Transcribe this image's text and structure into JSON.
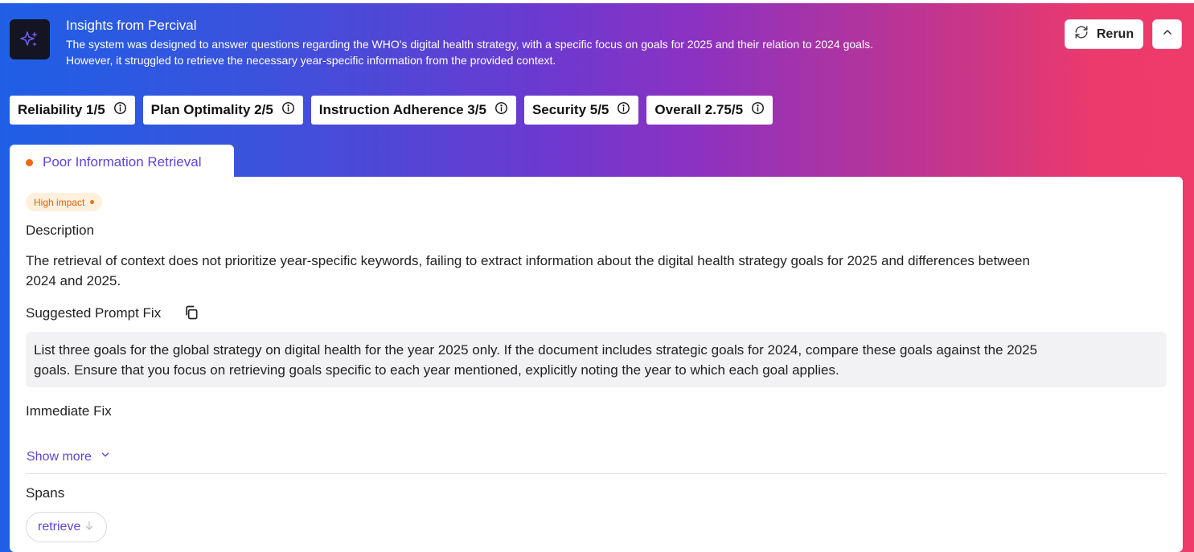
{
  "header": {
    "logo_icon": "sparkles-icon",
    "title": "Insights from Percival",
    "description_lines": [
      "The system was designed to answer questions regarding the WHO's digital health strategy, with a specific focus on goals for 2025 and their relation to 2024 goals.",
      "However, it struggled to retrieve the necessary year-specific information from the provided context."
    ],
    "rerun_label": "Rerun",
    "rerun_icon": "refresh-icon",
    "collapse_icon": "chevron-up-icon"
  },
  "scores": [
    {
      "label": "Reliability 1/5",
      "icon": "info-icon"
    },
    {
      "label": "Plan Optimality 2/5",
      "icon": "info-icon"
    },
    {
      "label": "Instruction Adherence 3/5",
      "icon": "info-icon"
    },
    {
      "label": "Security 5/5",
      "icon": "info-icon"
    },
    {
      "label": "Overall 2.75/5",
      "icon": "info-icon"
    }
  ],
  "tab": {
    "label": "Poor Information Retrieval",
    "dot_color": "#f06a12"
  },
  "issue": {
    "impact": "High impact",
    "description_heading": "Description",
    "description_lines": [
      "The retrieval of context does not prioritize year-specific keywords, failing to extract information about the digital health strategy goals for 2025 and differences between",
      "2024 and 2025."
    ],
    "prompt_fix_heading": "Suggested Prompt Fix",
    "prompt_fix_lines": [
      "List three goals for the global strategy on digital health for the year 2025 only. If the document includes strategic goals for 2024, compare these goals against the 2025",
      "goals. Ensure that you focus on retrieving goals specific to each year mentioned, explicitly noting the year to which each goal applies."
    ],
    "immediate_fix_heading": "Immediate Fix",
    "show_more_label": "Show more",
    "spans_heading": "Spans",
    "spans": [
      "retrieve"
    ]
  },
  "colors": {
    "accent": "#5b45db",
    "impact_text": "#d6660f",
    "impact_bg": "#fdf0dc"
  }
}
